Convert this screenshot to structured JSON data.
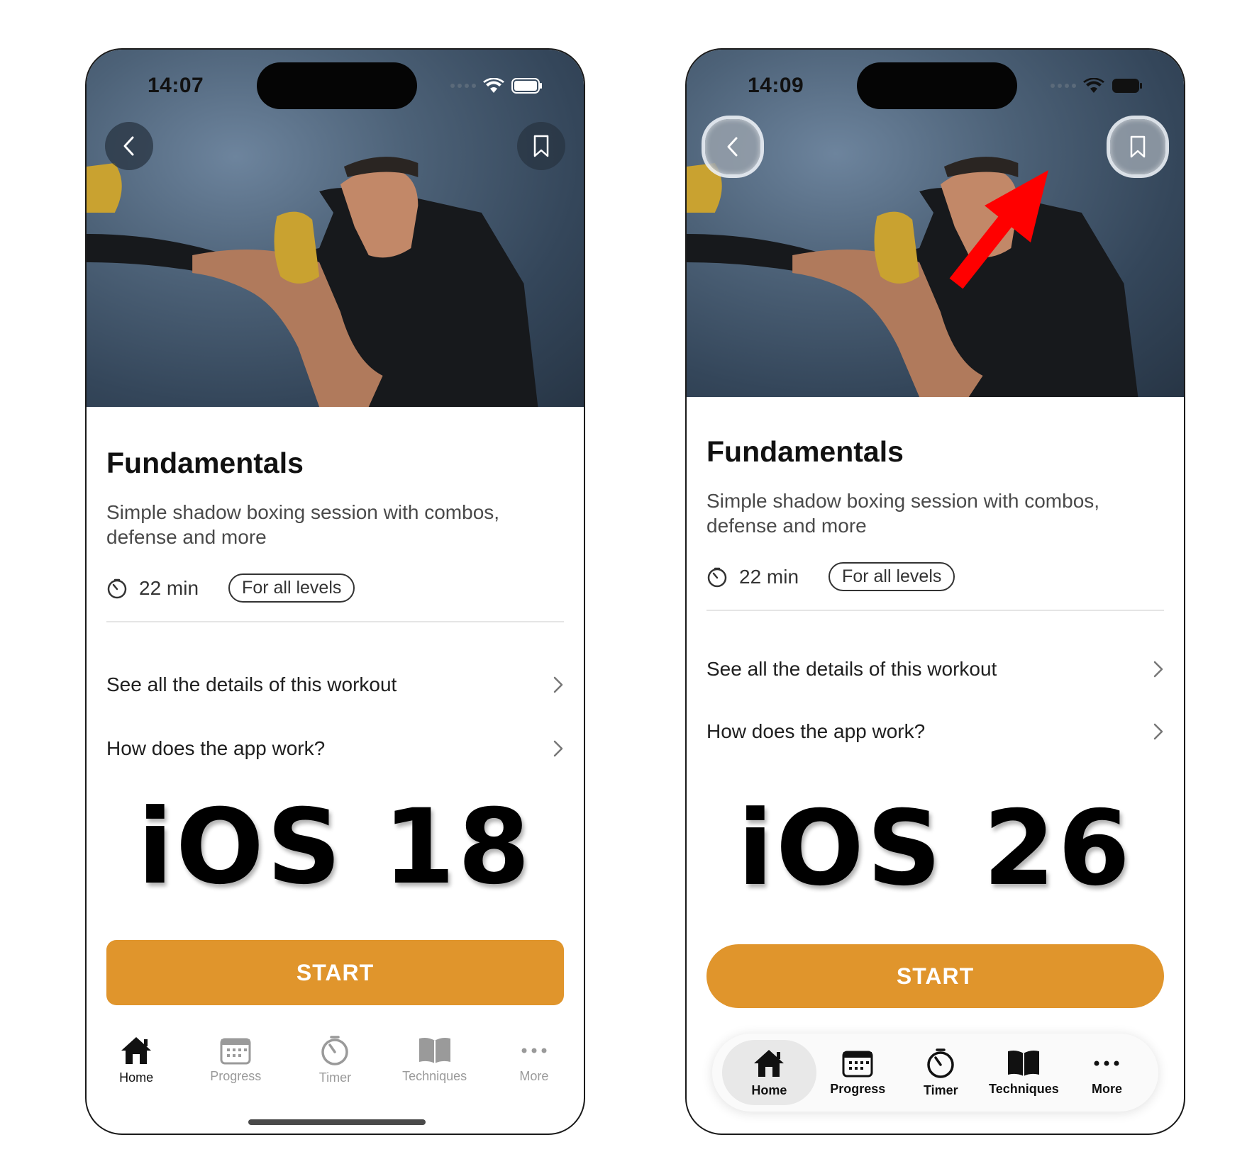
{
  "colors": {
    "accent": "#e0952c",
    "annotation_arrow": "#ff0000"
  },
  "phones": [
    {
      "status_time": "14:07",
      "title": "Fundamentals",
      "description": "Simple shadow boxing session with combos, defense and more",
      "duration": "22 min",
      "level": "For all levels",
      "links": [
        "See all the details of this workout",
        "How does the app work?"
      ],
      "os_label": "iOS 18",
      "start_label": "START",
      "tabs": [
        {
          "label": "Home",
          "icon": "home-icon",
          "active": true
        },
        {
          "label": "Progress",
          "icon": "calendar-icon",
          "active": false
        },
        {
          "label": "Timer",
          "icon": "timer-icon",
          "active": false
        },
        {
          "label": "Techniques",
          "icon": "book-icon",
          "active": false
        },
        {
          "label": "More",
          "icon": "more-icon",
          "active": false
        }
      ]
    },
    {
      "status_time": "14:09",
      "title": "Fundamentals",
      "description": "Simple shadow boxing session with combos, defense and more",
      "duration": "22 min",
      "level": "For all levels",
      "links": [
        "See all the details of this workout",
        "How does the app work?"
      ],
      "os_label": "iOS 26",
      "start_label": "START",
      "tabs": [
        {
          "label": "Home",
          "icon": "home-icon",
          "active": true
        },
        {
          "label": "Progress",
          "icon": "calendar-icon",
          "active": false
        },
        {
          "label": "Timer",
          "icon": "timer-icon",
          "active": false
        },
        {
          "label": "Techniques",
          "icon": "book-icon",
          "active": false
        },
        {
          "label": "More",
          "icon": "more-icon",
          "active": false
        }
      ]
    }
  ]
}
